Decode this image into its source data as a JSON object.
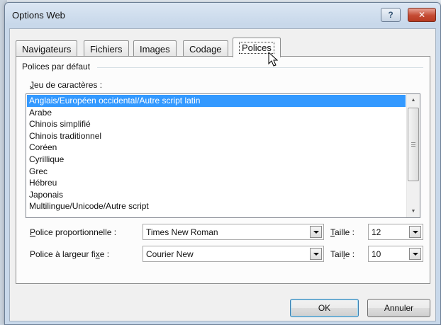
{
  "window": {
    "title": "Options Web"
  },
  "titlebar_buttons": {
    "help": "?",
    "close": "✕"
  },
  "tabs": [
    {
      "label": "Navigateurs"
    },
    {
      "label": "Fichiers"
    },
    {
      "label": "Images"
    },
    {
      "label": "Codage"
    },
    {
      "label": "Polices"
    }
  ],
  "active_tab": "Polices",
  "panel": {
    "group_label": "Polices par défaut",
    "charset_label_prefix": "J",
    "charset_label_rest": "eu de caractères :",
    "charsets": [
      "Anglais/Européen occidental/Autre script latin",
      "Arabe",
      "Chinois simplifié",
      "Chinois traditionnel",
      "Coréen",
      "Cyrillique",
      "Grec",
      "Hébreu",
      "Japonais",
      "Multilingue/Unicode/Autre script"
    ],
    "selected_charset": "Anglais/Européen occidental/Autre script latin",
    "proportional_label_prefix": "P",
    "proportional_label_rest": "olice proportionnelle :",
    "proportional_font": "Times New Roman",
    "size_label_1_prefix": "T",
    "size_label_1_rest": "aille :",
    "proportional_size": "12",
    "fixed_label_start": "Police à largeur fi",
    "fixed_label_u": "x",
    "fixed_label_end": "e :",
    "fixed_font": "Courier New",
    "size_label_2_start": "Tail",
    "size_label_2_u": "l",
    "size_label_2_end": "e :",
    "fixed_size": "10"
  },
  "buttons": {
    "ok": "OK",
    "cancel": "Annuler"
  }
}
